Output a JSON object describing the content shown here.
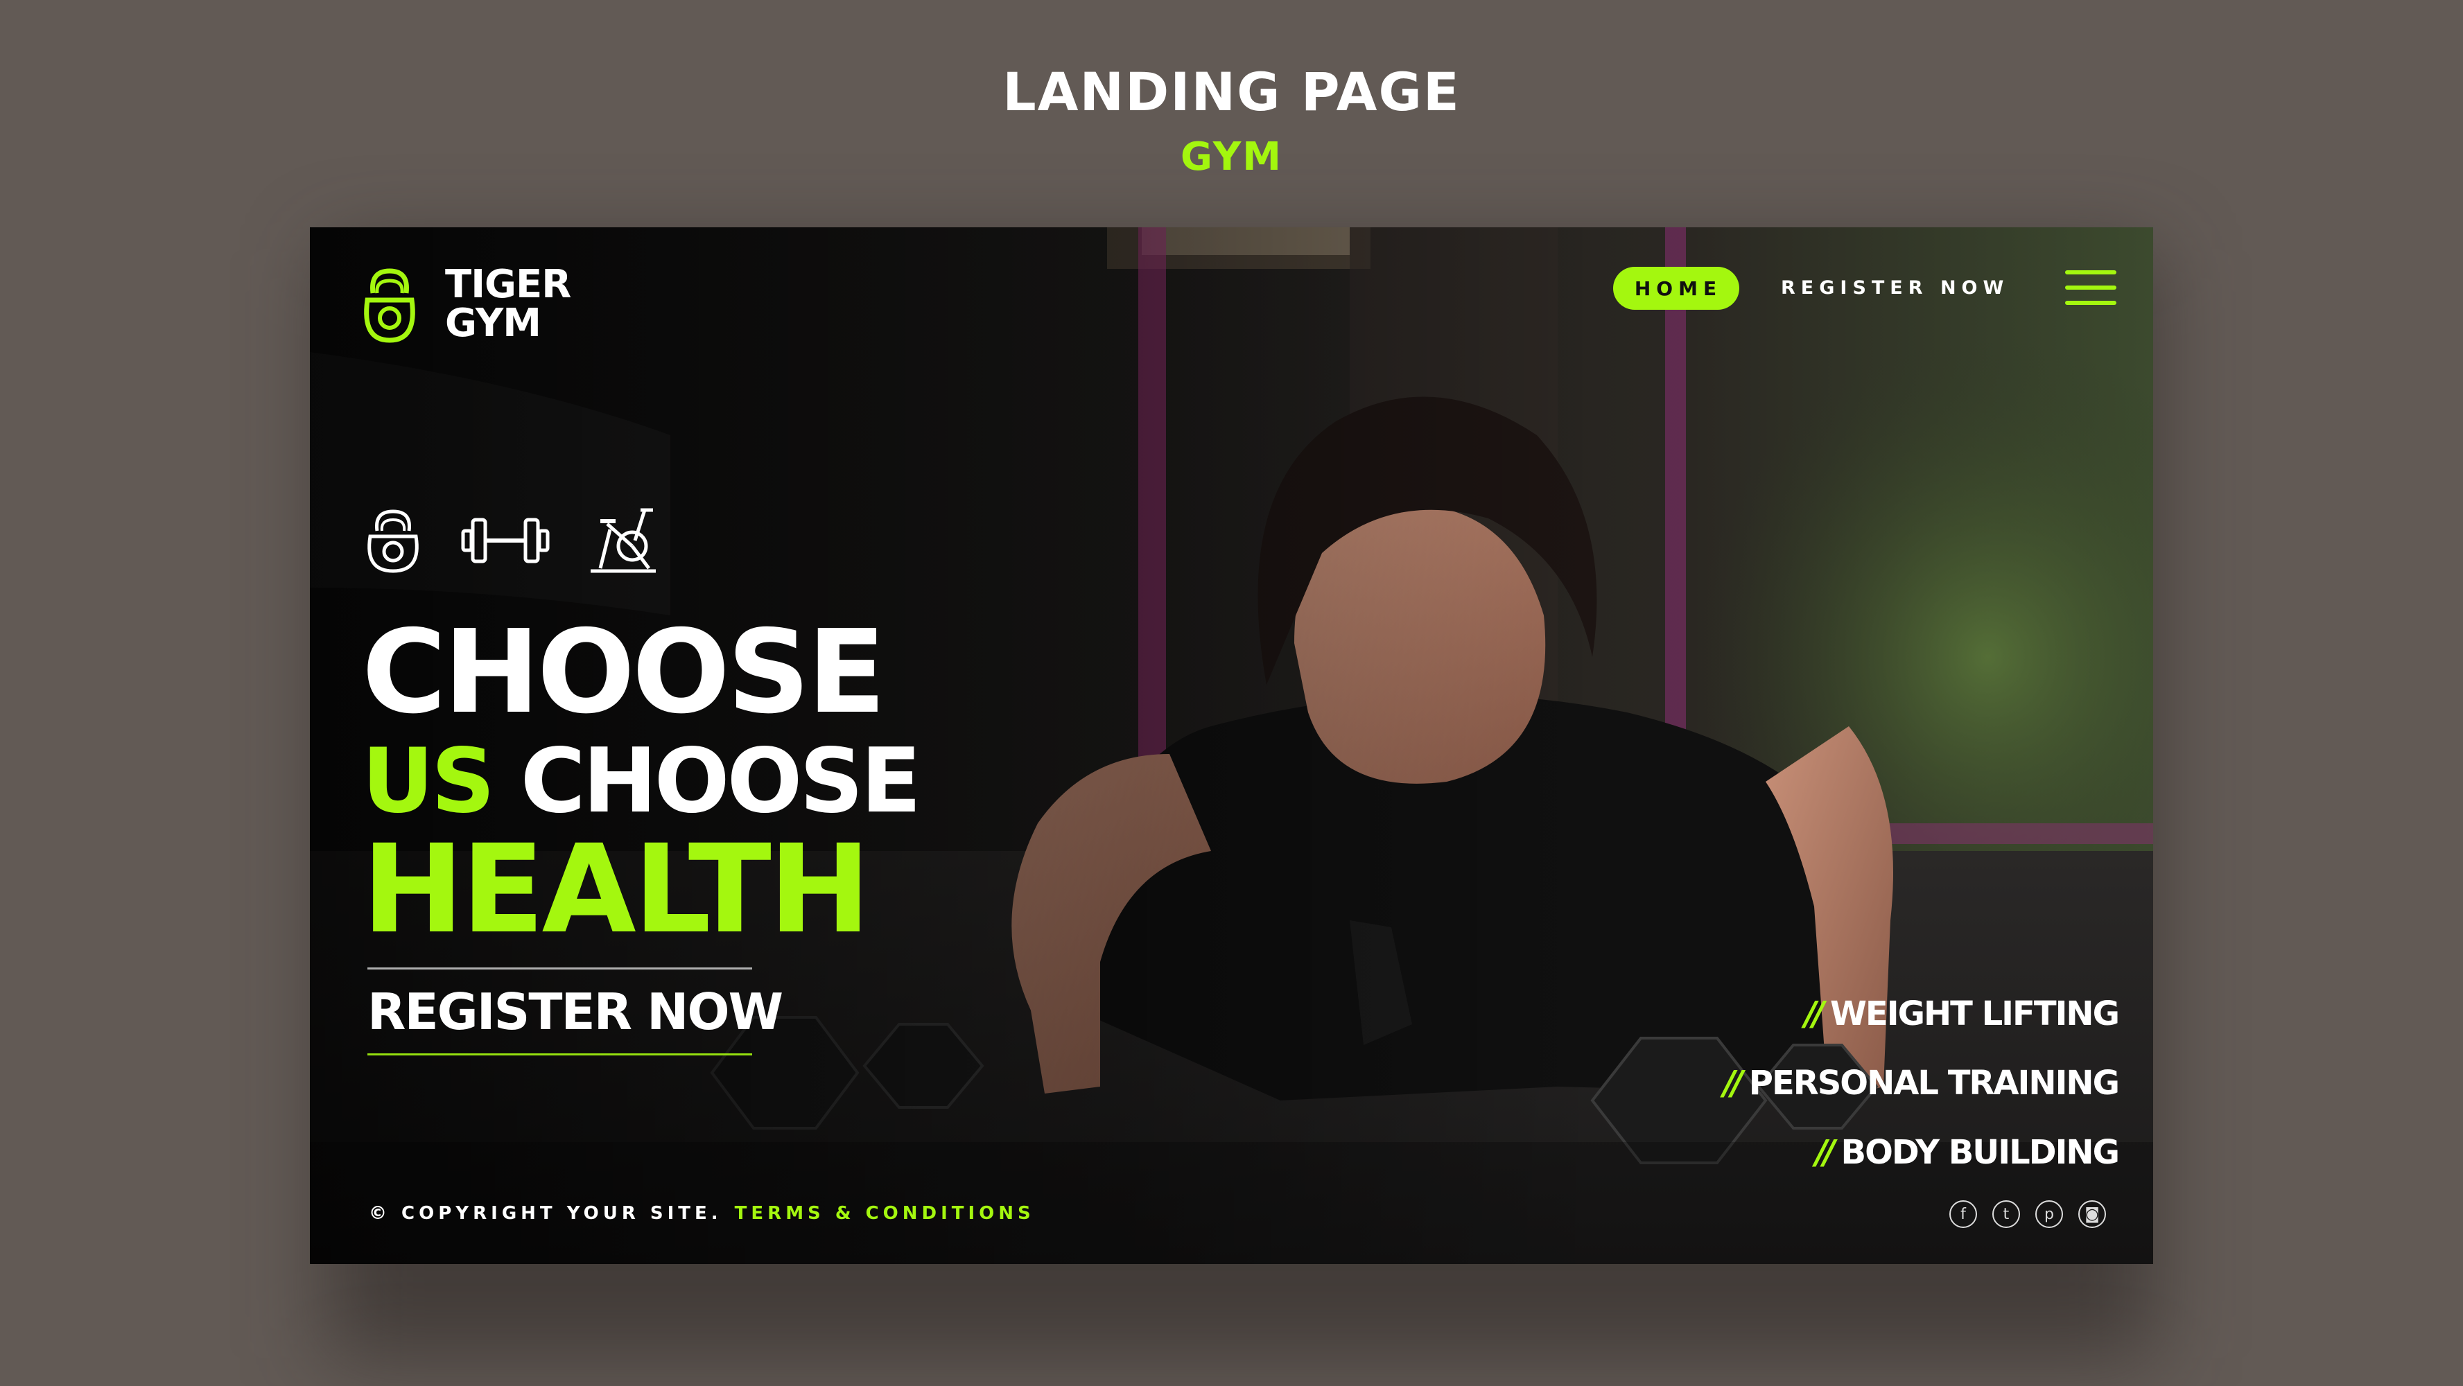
{
  "showcase": {
    "title": "LANDING PAGE",
    "subtitle": "GYM"
  },
  "brand": {
    "line1": "TIGER",
    "line2": "GYM",
    "logo_icon": "kettlebell-icon"
  },
  "nav": {
    "home_label": "HOME",
    "register_label": "REGISTER NOW",
    "menu_icon": "hamburger-menu-icon"
  },
  "feature_icons": [
    "kettlebell-icon",
    "dumbbell-icon",
    "exercise-bike-icon"
  ],
  "hero": {
    "line1": "CHOOSE",
    "line2_highlight": "US",
    "line2_rest": "CHOOSE",
    "line3": "HEALTH"
  },
  "cta": {
    "label": "REGISTER NOW"
  },
  "services": {
    "marker": "//",
    "items": [
      "WEIGHT LIFTING",
      "PERSONAL TRAINING",
      "BODY BUILDING"
    ]
  },
  "footer": {
    "copyright": "© COPYRIGHT YOUR SITE.",
    "terms": "TERMS & CONDITIONS"
  },
  "socials": [
    {
      "name": "facebook-icon",
      "glyph": "f"
    },
    {
      "name": "twitter-icon",
      "glyph": "t"
    },
    {
      "name": "pinterest-icon",
      "glyph": "p"
    },
    {
      "name": "instagram-icon",
      "glyph": "◙"
    }
  ],
  "colors": {
    "accent": "#a4f70f",
    "outer_background": "#625a55",
    "text": "#ffffff"
  }
}
